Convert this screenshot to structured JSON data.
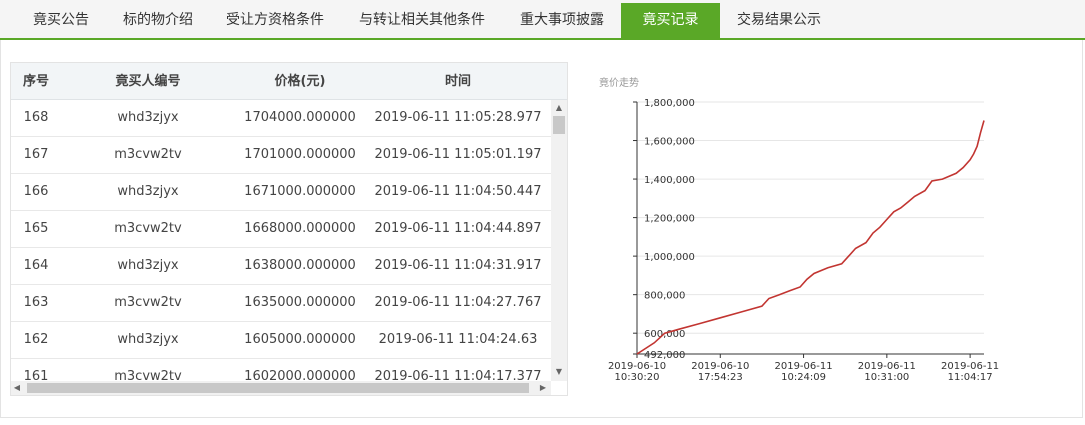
{
  "tabs": [
    {
      "label": "竟买公告"
    },
    {
      "label": "标的物介绍"
    },
    {
      "label": "受让方资格条件"
    },
    {
      "label": "与转让相关其他条件"
    },
    {
      "label": "重大事项披露"
    },
    {
      "label": "竟买记录",
      "active": true
    },
    {
      "label": "交易结果公示"
    }
  ],
  "table": {
    "headers": [
      "序号",
      "竟买人编号",
      "价格(元)",
      "时间"
    ],
    "rows": [
      {
        "no": "168",
        "bidder": "whd3zjyx",
        "price": "1704000.000000",
        "time": "2019-06-11 11:05:28.977"
      },
      {
        "no": "167",
        "bidder": "m3cvw2tv",
        "price": "1701000.000000",
        "time": "2019-06-11 11:05:01.197"
      },
      {
        "no": "166",
        "bidder": "whd3zjyx",
        "price": "1671000.000000",
        "time": "2019-06-11 11:04:50.447"
      },
      {
        "no": "165",
        "bidder": "m3cvw2tv",
        "price": "1668000.000000",
        "time": "2019-06-11 11:04:44.897"
      },
      {
        "no": "164",
        "bidder": "whd3zjyx",
        "price": "1638000.000000",
        "time": "2019-06-11 11:04:31.917"
      },
      {
        "no": "163",
        "bidder": "m3cvw2tv",
        "price": "1635000.000000",
        "time": "2019-06-11 11:04:27.767"
      },
      {
        "no": "162",
        "bidder": "whd3zjyx",
        "price": "1605000.000000",
        "time": "2019-06-11 11:04:24.63"
      },
      {
        "no": "161",
        "bidder": "m3cvw2tv",
        "price": "1602000.000000",
        "time": "2019-06-11 11:04:17.377"
      }
    ]
  },
  "chart_data": {
    "type": "line",
    "title": "竟价走势",
    "xlabel": "",
    "ylabel": "",
    "ylim": [
      492000,
      1800000
    ],
    "yticks": [
      "492,000",
      "600,000",
      "800,000",
      "1,000,000",
      "1,200,000",
      "1,400,000",
      "1,600,000",
      "1,800,000"
    ],
    "ytick_values": [
      492000,
      600000,
      800000,
      1000000,
      1200000,
      1400000,
      1600000,
      1800000
    ],
    "xticks": [
      {
        "date": "2019-06-10",
        "time": "10:30:20",
        "pos": 0
      },
      {
        "date": "2019-06-10",
        "time": "17:54:23",
        "pos": 0.24
      },
      {
        "date": "2019-06-11",
        "time": "10:24:09",
        "pos": 0.48
      },
      {
        "date": "2019-06-11",
        "time": "10:31:00",
        "pos": 0.72
      },
      {
        "date": "2019-06-11",
        "time": "11:04:17",
        "pos": 0.96
      }
    ],
    "line_color": "#c23531",
    "series": [
      {
        "values": [
          [
            0,
            492000
          ],
          [
            0.05,
            550000
          ],
          [
            0.08,
            600000
          ],
          [
            0.12,
            620000
          ],
          [
            0.18,
            650000
          ],
          [
            0.24,
            680000
          ],
          [
            0.3,
            710000
          ],
          [
            0.36,
            740000
          ],
          [
            0.38,
            780000
          ],
          [
            0.41,
            800000
          ],
          [
            0.44,
            820000
          ],
          [
            0.47,
            840000
          ],
          [
            0.49,
            880000
          ],
          [
            0.51,
            910000
          ],
          [
            0.55,
            940000
          ],
          [
            0.59,
            960000
          ],
          [
            0.61,
            1000000
          ],
          [
            0.63,
            1040000
          ],
          [
            0.66,
            1070000
          ],
          [
            0.68,
            1120000
          ],
          [
            0.7,
            1150000
          ],
          [
            0.72,
            1190000
          ],
          [
            0.74,
            1230000
          ],
          [
            0.76,
            1250000
          ],
          [
            0.78,
            1280000
          ],
          [
            0.8,
            1310000
          ],
          [
            0.83,
            1340000
          ],
          [
            0.85,
            1390000
          ],
          [
            0.88,
            1400000
          ],
          [
            0.92,
            1430000
          ],
          [
            0.94,
            1460000
          ],
          [
            0.96,
            1500000
          ],
          [
            0.97,
            1530000
          ],
          [
            0.98,
            1570000
          ],
          [
            0.99,
            1640000
          ],
          [
            1.0,
            1704000
          ]
        ]
      }
    ]
  }
}
